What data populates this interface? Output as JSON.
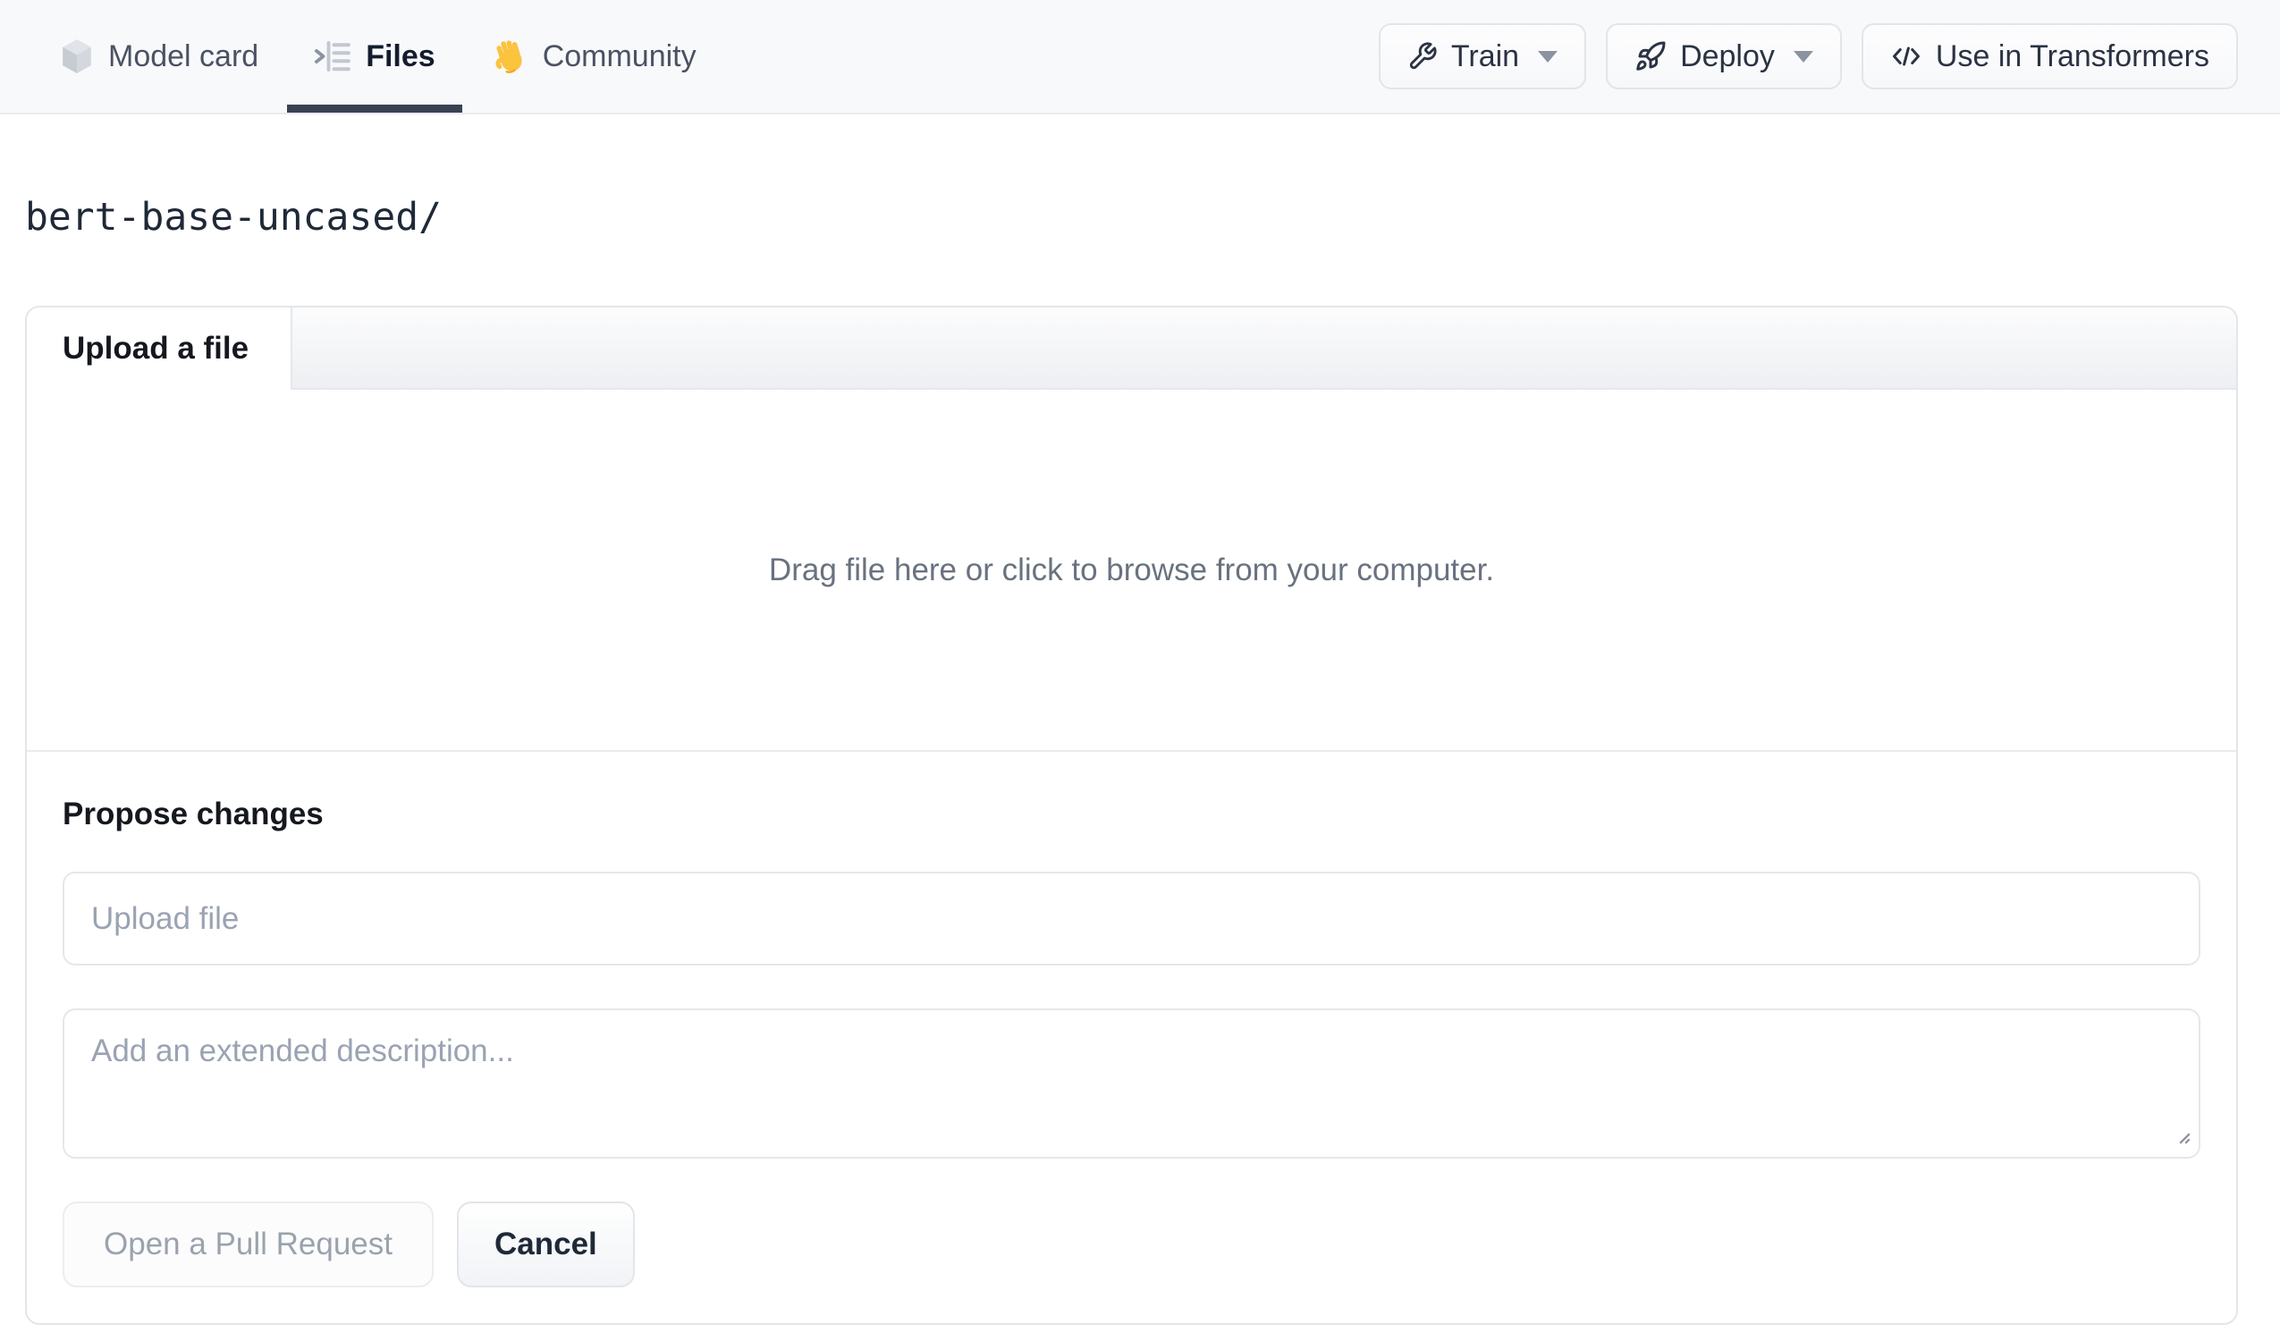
{
  "header": {
    "tabs": [
      {
        "label": "Model card"
      },
      {
        "label": "Files"
      },
      {
        "label": "Community"
      }
    ],
    "actions": {
      "train_label": "Train",
      "deploy_label": "Deploy",
      "use_in_transformers_label": "Use in Transformers"
    }
  },
  "breadcrumb": {
    "path": "bert-base-uncased/"
  },
  "upload_card": {
    "tab_label": "Upload a file",
    "dropzone_text": "Drag file here or click to browse from your computer.",
    "propose": {
      "heading": "Propose changes",
      "file_input_placeholder": "Upload file",
      "description_placeholder": "Add an extended description...",
      "open_pr_label": "Open a Pull Request",
      "cancel_label": "Cancel"
    }
  },
  "colors": {
    "topbar_bg": "#f8f9fb",
    "active_tab_underline": "#394253",
    "border": "#e5e7eb",
    "muted_text": "#69727f",
    "placeholder": "#9aa3b2",
    "hand_emoji": "#fcc33f"
  }
}
